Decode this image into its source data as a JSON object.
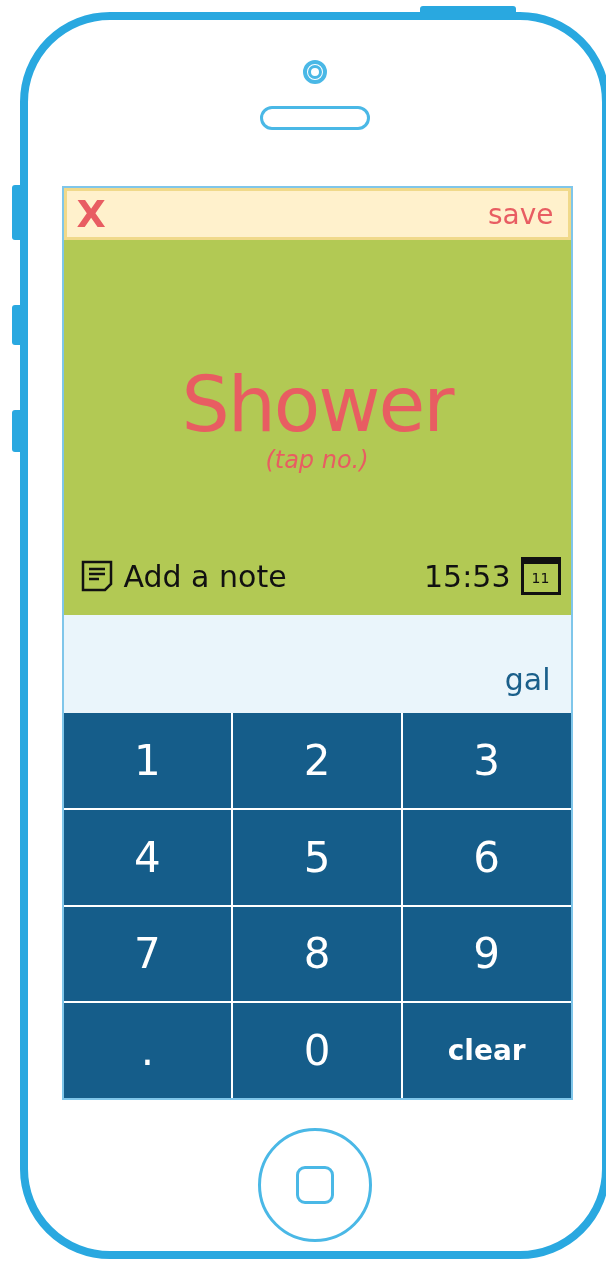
{
  "top_bar": {
    "close": "X",
    "save": "save"
  },
  "activity": {
    "title": "Shower",
    "hint": "(tap no.)"
  },
  "note": {
    "label": "Add a note"
  },
  "time": "15:53",
  "calendar_day": "11",
  "amount": {
    "unit": "gal"
  },
  "keypad": {
    "rows": [
      [
        {
          "label": "1",
          "kind": "digit"
        },
        {
          "label": "2",
          "kind": "digit"
        },
        {
          "label": "3",
          "kind": "digit"
        }
      ],
      [
        {
          "label": "4",
          "kind": "digit"
        },
        {
          "label": "5",
          "kind": "digit"
        },
        {
          "label": "6",
          "kind": "digit"
        }
      ],
      [
        {
          "label": "7",
          "kind": "digit"
        },
        {
          "label": "8",
          "kind": "digit"
        },
        {
          "label": "9",
          "kind": "digit"
        }
      ],
      [
        {
          "label": ".",
          "kind": "digit"
        },
        {
          "label": "0",
          "kind": "digit"
        },
        {
          "label": "clear",
          "kind": "action"
        }
      ]
    ]
  }
}
